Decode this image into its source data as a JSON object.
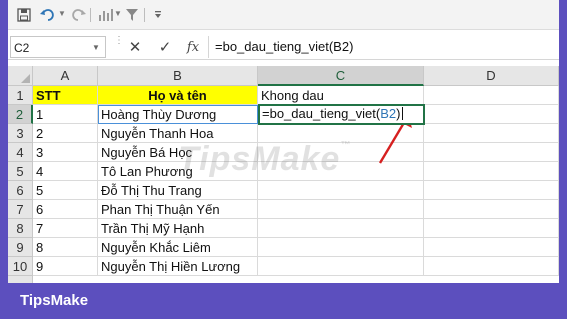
{
  "toolbar": {
    "icons": [
      "save-icon",
      "undo-icon",
      "redo-icon",
      "chart-icon",
      "filter-icon",
      "customize-icon"
    ]
  },
  "formula_bar": {
    "name_box": "C2",
    "cancel": "✕",
    "enter": "✓",
    "fx": "fx",
    "formula": "=bo_dau_tieng_viet(B2)"
  },
  "columns": [
    "A",
    "B",
    "C",
    "D"
  ],
  "rows": [
    "1",
    "2",
    "3",
    "4",
    "5",
    "6",
    "7",
    "8",
    "9",
    "10"
  ],
  "header_row": {
    "a": "STT",
    "b": "Họ và tên",
    "c": "Khong dau"
  },
  "data_rows": [
    {
      "a": "1",
      "b": "Hoàng Thùy Dương"
    },
    {
      "a": "2",
      "b": "Nguyễn Thanh Hoa"
    },
    {
      "a": "3",
      "b": "Nguyễn Bá Học"
    },
    {
      "a": "4",
      "b": "Tô Lan Phương"
    },
    {
      "a": "5",
      "b": "Đỗ Thị Thu Trang"
    },
    {
      "a": "6",
      "b": "Phan Thị Thuận Yến"
    },
    {
      "a": "7",
      "b": "Trần Thị Mỹ Hạnh"
    },
    {
      "a": "8",
      "b": "Nguyễn Khắc Liêm"
    },
    {
      "a": "9",
      "b": "Nguyễn Thị Hiền Lương"
    }
  ],
  "editing_cell": {
    "before_ref": "=bo_dau_tieng_viet(",
    "ref": "B2",
    "after_ref": ")"
  },
  "watermark": {
    "text": "TipsMake",
    "tm": "™"
  },
  "brand": "TipsMake",
  "colors": {
    "background": "#5c4fbe",
    "header_fill": "#ffff00",
    "active_border": "#217346",
    "reference": "#2e75b6",
    "arrow": "#d62020"
  }
}
